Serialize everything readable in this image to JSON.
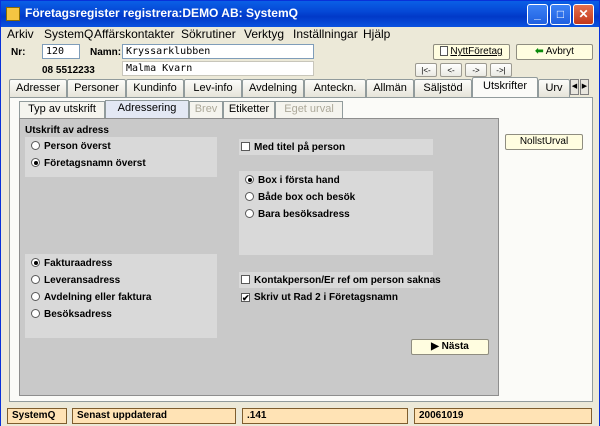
{
  "window": {
    "title": "Företagsregister registrera:DEMO AB: SystemQ"
  },
  "menu": [
    "Arkiv",
    "SystemQ",
    "Affärskontakter",
    "Sökrutiner",
    "Verktyg",
    "Inställningar",
    "Hjälp"
  ],
  "header": {
    "nr_label": "Nr:",
    "nr_value": "120",
    "phone": "08 5512233",
    "namn_label": "Namn:",
    "name_value": "Kryssarklubben",
    "name2_value": "Malma Kvarn",
    "new_company_label": "NyttFöretag",
    "cancel_label": "Avbryt",
    "nav": [
      "|<-",
      "<-",
      "->",
      "->|"
    ]
  },
  "tabs": [
    "Adresser",
    "Personer",
    "Kundinfo",
    "Lev-info",
    "Avdelning",
    "Anteckn.",
    "Allmän",
    "Säljstöd",
    "Utskrifter",
    "Urv"
  ],
  "subtabs": [
    "Typ av utskrift",
    "Adressering",
    "Brev",
    "Etiketter",
    "Eget urval"
  ],
  "content": {
    "section_title": "Utskrift av adress",
    "name_order": [
      "Person överst",
      "Företagsnamn överst"
    ],
    "med_titel": "Med titel på person",
    "box_options": [
      "Box i första hand",
      "Både box och besök",
      "Bara besöksadress"
    ],
    "address_types": [
      "Fakturaadress",
      "Leveransadress",
      "Avdelning eller faktura",
      "Besöksadress"
    ],
    "kontakt_check": "Kontakperson/Er ref om person saknas",
    "rad2_check": "Skriv ut Rad 2 i Företagsnamn",
    "next_label": "Nästa",
    "nollst_label": "NollstUrval"
  },
  "status": {
    "app": "SystemQ",
    "updated_label": "Senast uppdaterad",
    "code": ".141",
    "date": "20061019"
  }
}
